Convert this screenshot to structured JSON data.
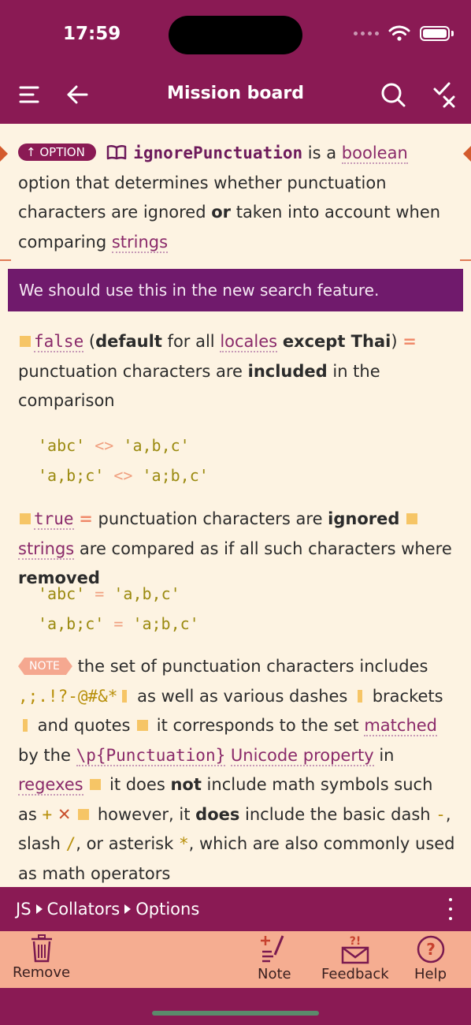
{
  "status": {
    "time": "17:59"
  },
  "header": {
    "title": "Mission board"
  },
  "intro": {
    "tag": "OPTION",
    "option_name": "ignorePunctuation",
    "t1": " is a ",
    "link_boolean": "boolean",
    "t2": " option that determines whether punctuation characters are ignored ",
    "or": "or",
    "t3": " taken into account when comparing ",
    "link_strings": "strings"
  },
  "note_banner": "We should use this in the new search feature.",
  "false_item": {
    "value": "false",
    "open_paren": " (",
    "default": "default",
    "t1": " for all ",
    "link_locales": "locales",
    "sp": " ",
    "except": "except Thai",
    "close_paren": ") ",
    "eq": "=",
    "t2": " punctuation characters are ",
    "included": "included",
    "t3": " in the comparison"
  },
  "false_code": [
    {
      "a": "'abc'",
      "op": "<>",
      "b": "'a,b,c'"
    },
    {
      "a": "'a,b;c'",
      "op": "<>",
      "b": "'a;b,c'"
    }
  ],
  "true_item": {
    "value": "true",
    "eq": "=",
    "t1": " punctuation characters are ",
    "ignored": "ignored",
    "link_strings": "strings",
    "t2": " are compared as if all such characters where ",
    "removed": "removed"
  },
  "true_code": [
    {
      "a": "'abc'",
      "op": "=",
      "b": "'a,b,c'"
    },
    {
      "a": "'a,b;c'",
      "op": "=",
      "b": "'a;b,c'"
    }
  ],
  "note": {
    "tag": "NOTE",
    "t1": " the set of punctuation characters includes ",
    "chars": ",;.!?-@#&*",
    "t2": " as well as various dashes ",
    "t3": " brackets ",
    "t4": " and quotes ",
    "t5": " it corresponds to the set ",
    "link_matched": "matched",
    "t6": " by the ",
    "code_link": "\\p{Punctuation}",
    "sp": " ",
    "link_unicode": "Unicode property",
    "t7": " in ",
    "link_regexes": "regexes",
    "t8": " it does ",
    "not": "not",
    "t9": " include math symbols such as ",
    "plus": "+",
    "times": "✕",
    "t10": " however, it ",
    "does": "does",
    "t11": " include the basic dash ",
    "dash": "-",
    "t12": ", slash ",
    "slash": "/",
    "t13": ", or asterisk ",
    "star": "*",
    "t14": ", which are also commonly used as math operators"
  },
  "breadcrumb": {
    "items": [
      "JS",
      "Collators",
      "Options"
    ]
  },
  "toolbar": {
    "remove": "Remove",
    "note": "Note",
    "feedback": "Feedback",
    "help": "Help"
  },
  "colors": {
    "brand": "#8a1a54",
    "banner": "#701a6c",
    "toolbar": "#f5ad91",
    "background": "#fdf3e2"
  }
}
